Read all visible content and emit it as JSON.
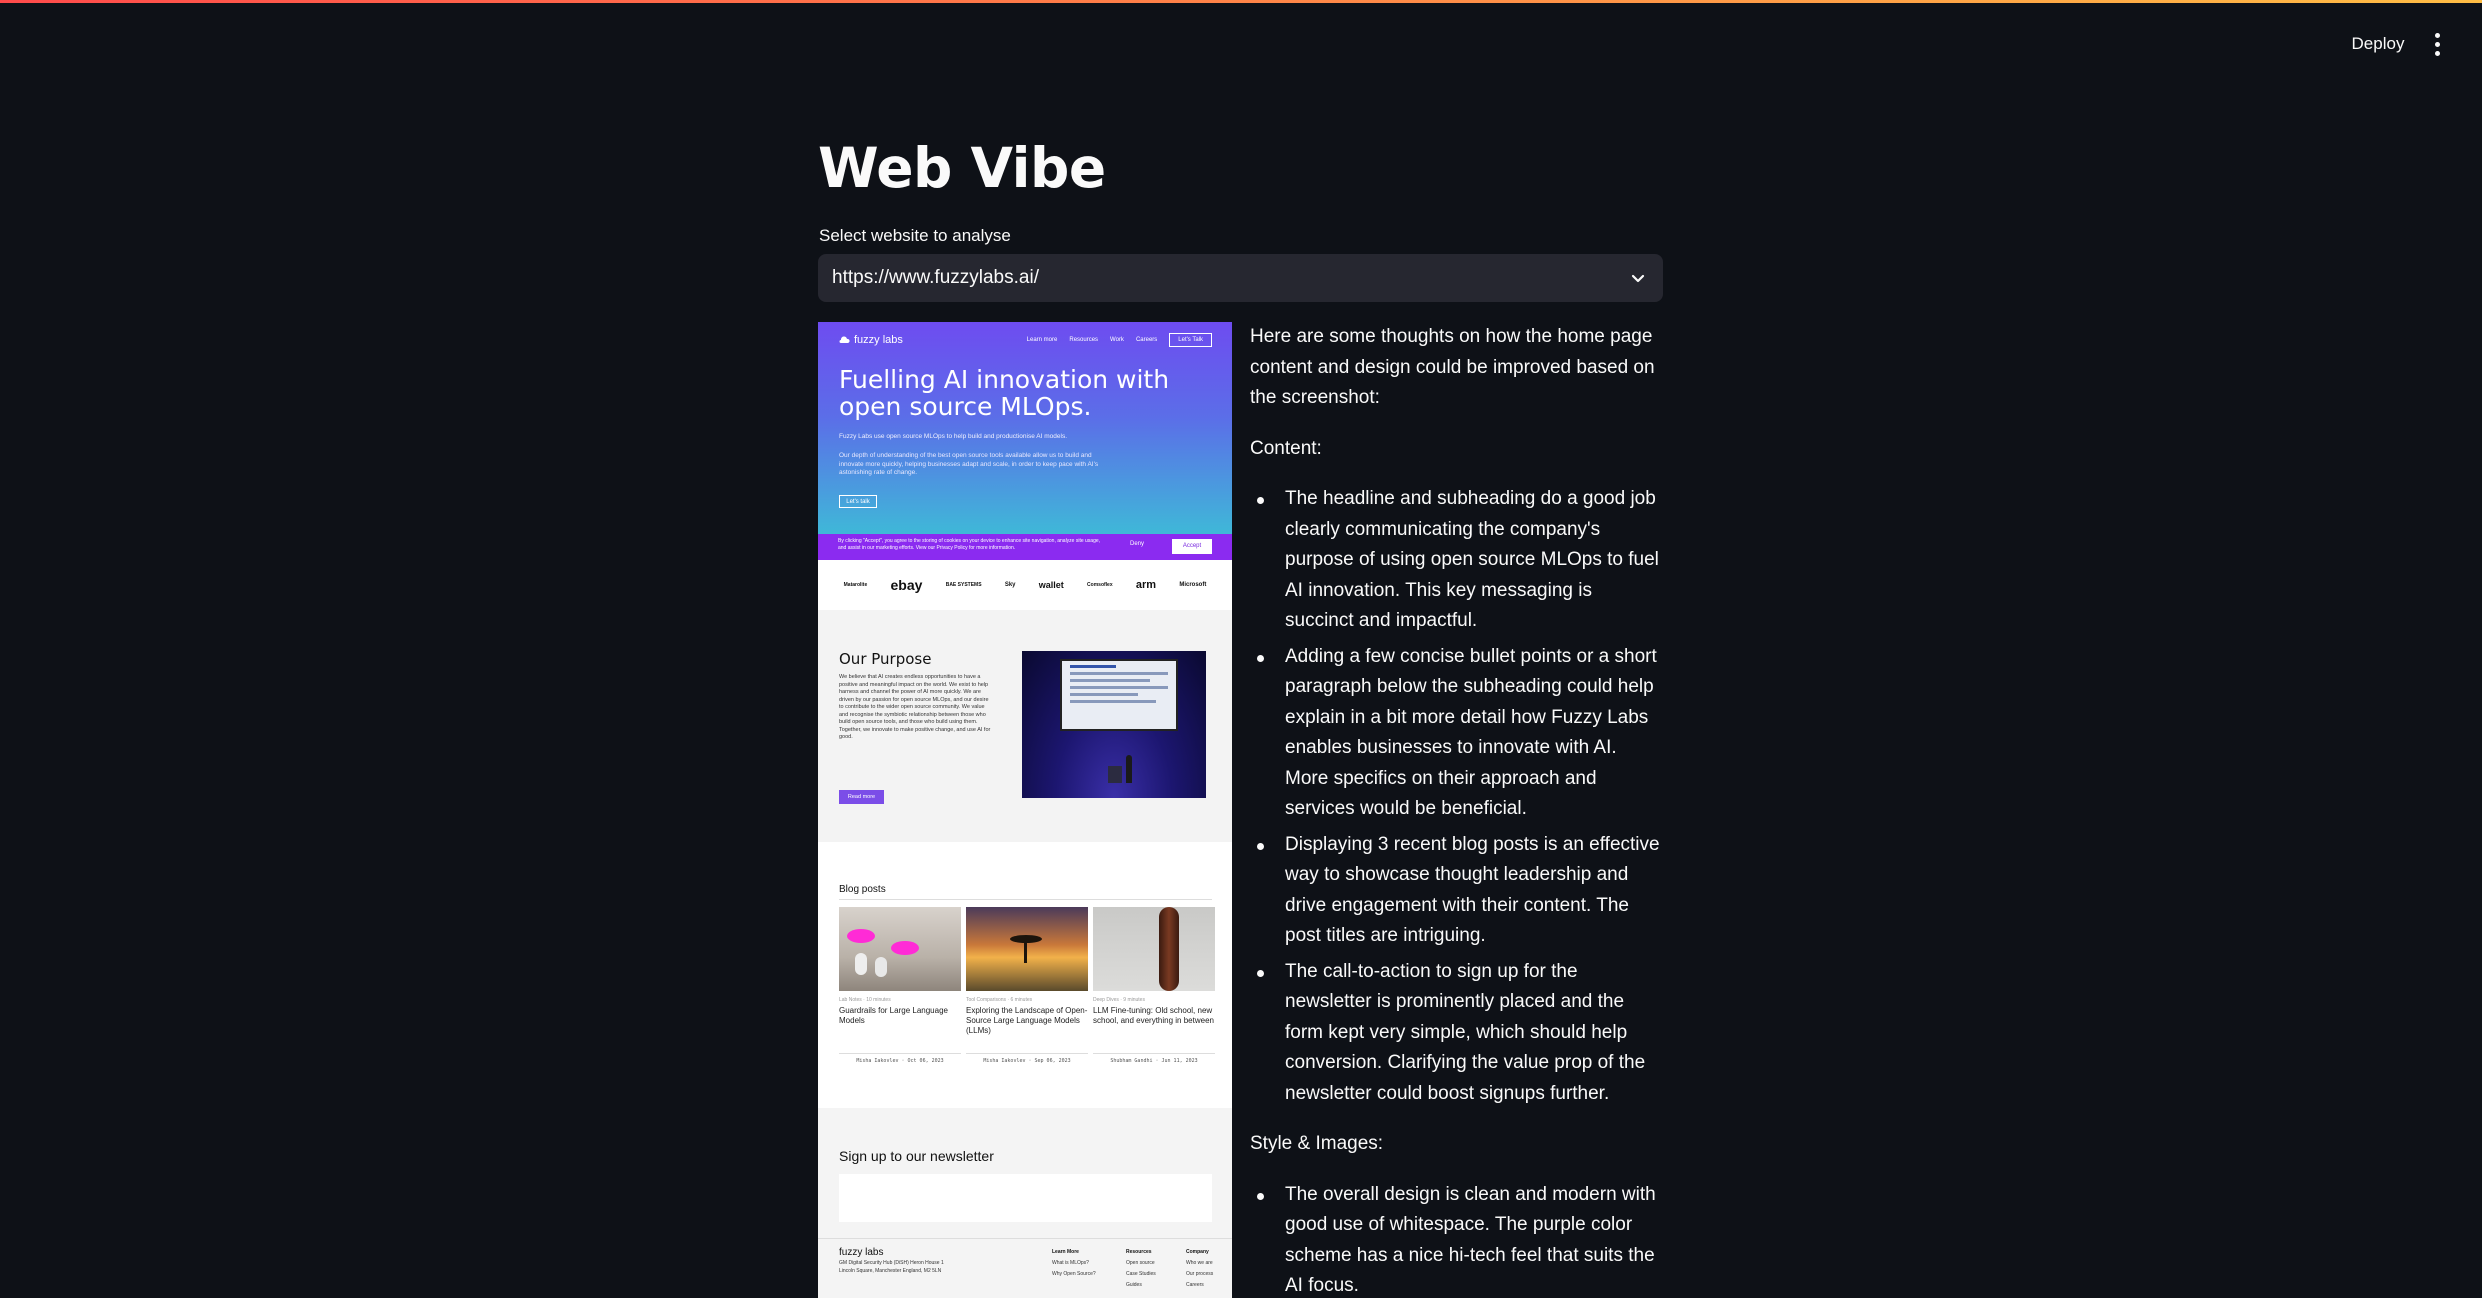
{
  "header": {
    "deploy_label": "Deploy",
    "menu_icon": "kebab-vertical-icon"
  },
  "page": {
    "title": "Web Vibe",
    "select_label": "Select website to analyse",
    "selected_site": "https://www.fuzzylabs.ai/"
  },
  "site": {
    "nav": {
      "logo": "fuzzy labs",
      "links": [
        "Learn more",
        "Resources",
        "Work",
        "Careers"
      ],
      "cta": "Let's Talk"
    },
    "hero": {
      "headline": "Fuelling AI innovation with open source MLOps.",
      "subheading": "Fuzzy Labs use open source MLOps to help build and productionise AI models.",
      "paragraph": "Our depth of understanding of the best open source tools available allow us to build and innovate more quickly, helping businesses adapt and scale, in order to keep pace with AI's astonishing rate of change.",
      "button": "Let's talk"
    },
    "cookie": {
      "text": "By clicking \"Accept\", you agree to the storing of cookies on your device to enhance site navigation, analyze site usage, and assist in our marketing efforts. View our Privacy Policy for more information.",
      "deny": "Deny",
      "accept": "Accept"
    },
    "logos": [
      "Matarolite",
      "ebay",
      "BAE SYSTEMS",
      "Sky",
      "wallet",
      "Comsoflex",
      "arm",
      "Microsoft"
    ],
    "purpose": {
      "title": "Our Purpose",
      "text": "We believe that AI creates endless opportunities to have a positive and meaningful impact on the world. We exist to help harness and channel the power of AI more quickly. We are driven by our passion for open source MLOps, and our desire to contribute to the wider open source community. We value and recognise the symbiotic relationship between those who build open source tools, and those who build using them. Together, we innovate to make positive change, and use AI for good.",
      "button": "Read more"
    },
    "blog": {
      "title": "Blog posts",
      "posts": [
        {
          "meta": "Lab Notes · 10 minutes",
          "title": "Guardrails for Large Language Models",
          "author": "Misha Iakovlev · Oct 06, 2023"
        },
        {
          "meta": "Tool Comparisons · 6 minutes",
          "title": "Exploring the Landscape of Open-Source Large Language Models (LLMs)",
          "author": "Misha Iakovlev · Sep 06, 2023"
        },
        {
          "meta": "Deep Dives · 9 minutes",
          "title": "LLM Fine-tuning: Old school, new school, and everything in between",
          "author": "Shubham Gandhi · Jun 11, 2023"
        }
      ]
    },
    "newsletter": {
      "title": "Sign up to our newsletter"
    },
    "footer": {
      "logo": "fuzzy labs",
      "address": "GM Digital Security Hub (DiSH) Heron House 1 Lincoln Square, Manchester England, M2 5LN",
      "columns": [
        {
          "head": "Learn More",
          "items": [
            "What is MLOps?",
            "Why Open Source?"
          ]
        },
        {
          "head": "Resources",
          "items": [
            "Open source",
            "Case Studies",
            "Guides"
          ]
        },
        {
          "head": "Company",
          "items": [
            "Who we are",
            "Our process",
            "Careers"
          ]
        }
      ]
    }
  },
  "analysis": {
    "intro": "Here are some thoughts on how the home page content and design could be improved based on the screenshot:",
    "content_heading": "Content:",
    "content_points": [
      "The headline and subheading do a good job clearly communicating the company's purpose of using open source MLOps to fuel AI innovation. This key messaging is succinct and impactful.",
      "Adding a few concise bullet points or a short paragraph below the subheading could help explain in a bit more detail how Fuzzy Labs enables businesses to innovate with AI. More specifics on their approach and services would be beneficial.",
      "Displaying 3 recent blog posts is an effective way to showcase thought leadership and drive engagement with their content. The post titles are intriguing.",
      "The call-to-action to sign up for the newsletter is prominently placed and the form kept very simple, which should help conversion. Clarifying the value prop of the newsletter could boost signups further."
    ],
    "style_heading": "Style & Images:",
    "style_points": [
      "The overall design is clean and modern with good use of whitespace. The purple color scheme has a nice hi-tech feel that suits the AI focus."
    ]
  },
  "colors": {
    "background": "#0e1117",
    "select_bg": "#262730",
    "brand_purple": "#6e4cf0",
    "cookie_purple": "#8b2bf0"
  }
}
